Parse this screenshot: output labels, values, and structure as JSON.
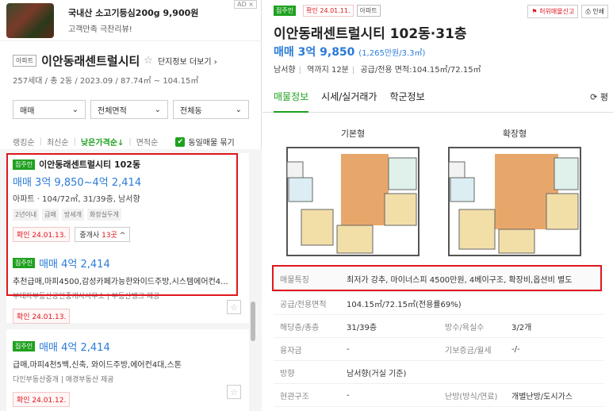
{
  "ad": {
    "title": "국내산 소고기등심200g 9,900원",
    "subtitle": "고객만족 극찬리뷰!",
    "badge": "AD ×"
  },
  "complex": {
    "type_tag": "아파트",
    "name": "이안동래센트럴시티",
    "star": "☆",
    "more": "단지정보 더보기",
    "more_chevron": "›",
    "stats": "257세대 / 총 2동 / 2023.09 / 87.74㎡ ~ 104.15㎡"
  },
  "filters": [
    {
      "label": "매매"
    },
    {
      "label": "전체면적"
    },
    {
      "label": "전체동"
    }
  ],
  "sort": {
    "options": [
      "랭킹순",
      "최신순",
      "낮은가격순↓",
      "면적순"
    ],
    "active_index": 2,
    "same_listing_label": "동일매물 묶기",
    "same_listing_checked": true
  },
  "listings": [
    {
      "badge": "집주인",
      "title": "이안동래센트럴시티 102동",
      "price": "매매 3억 9,850~4억 2,414",
      "spec": "아파트 · 104/72㎡, 31/39층, 남서향",
      "tags": [
        "2년이내",
        "급매",
        "방세개",
        "화장실두개"
      ],
      "verified": "확인 24.01.13.",
      "agents_label": "중개사",
      "agents_count": "13곳",
      "agents_suffix": "^"
    },
    {
      "badge": "집주인",
      "price": "매매 4억 2,414",
      "desc": "추천급매,마피4500,감성카페가능한와이드주방,시스템에어컨4...",
      "agents": "부대자부동산공인중개사사무소 | 부동산뱅크 제공",
      "verified": "확인 24.01.13."
    },
    {
      "badge": "집주인",
      "price": "매매 4억 2,414",
      "desc": "급매,마피4천5백,신축, 와이드주방,에어컨4대,스톤",
      "agents": "다인부동산중개 | 매경부동산 제공",
      "verified": "확인 24.01.12."
    }
  ],
  "detail": {
    "badge": "집주인",
    "verified": "확인 24.01.11.",
    "type_tag": "아파트",
    "report_label": "허위매물신고",
    "print_label": "인쇄",
    "title": "이안동래센트럴시티 102동·31층",
    "price_label": "매매",
    "price": "3억 9,850",
    "price_per": "(1,265만원/3.3㎡)",
    "sub": [
      "남서향",
      "역까지 12분",
      "공급/전용 면적:104.15㎡/72.15㎡"
    ],
    "tabs": [
      "매물정보",
      "시세/실거래가",
      "학군정보"
    ],
    "active_tab": 0,
    "refresh_label": "⟳ 평",
    "plans": [
      "기본형",
      "확장형"
    ],
    "info": {
      "feature_key": "매물특징",
      "feature_val": "최저가 강추, 마이너스피 4500만원, 4베이구조, 확장비,옵션비 별도",
      "area_key": "공급/전용면적",
      "area_val": "104.15㎡/72.15㎡(전용률69%)",
      "floor_key": "해당층/총층",
      "floor_val": "31/39층",
      "rooms_key": "방수/욕실수",
      "rooms_val": "3/2개",
      "loan_key": "융자금",
      "loan_val": "-",
      "deposit_key": "기보증금/월세",
      "deposit_val": "-/-",
      "dir_key": "방향",
      "dir_val": "남서향(거실 기준)",
      "struct_key": "현관구조",
      "struct_val": "-",
      "heat_key": "난방(방식/연료)",
      "heat_val": "개별난방/도시가스"
    }
  },
  "colors": {
    "green": "#1fa11f",
    "blue": "#2a7bd8",
    "red": "#e0161e"
  }
}
